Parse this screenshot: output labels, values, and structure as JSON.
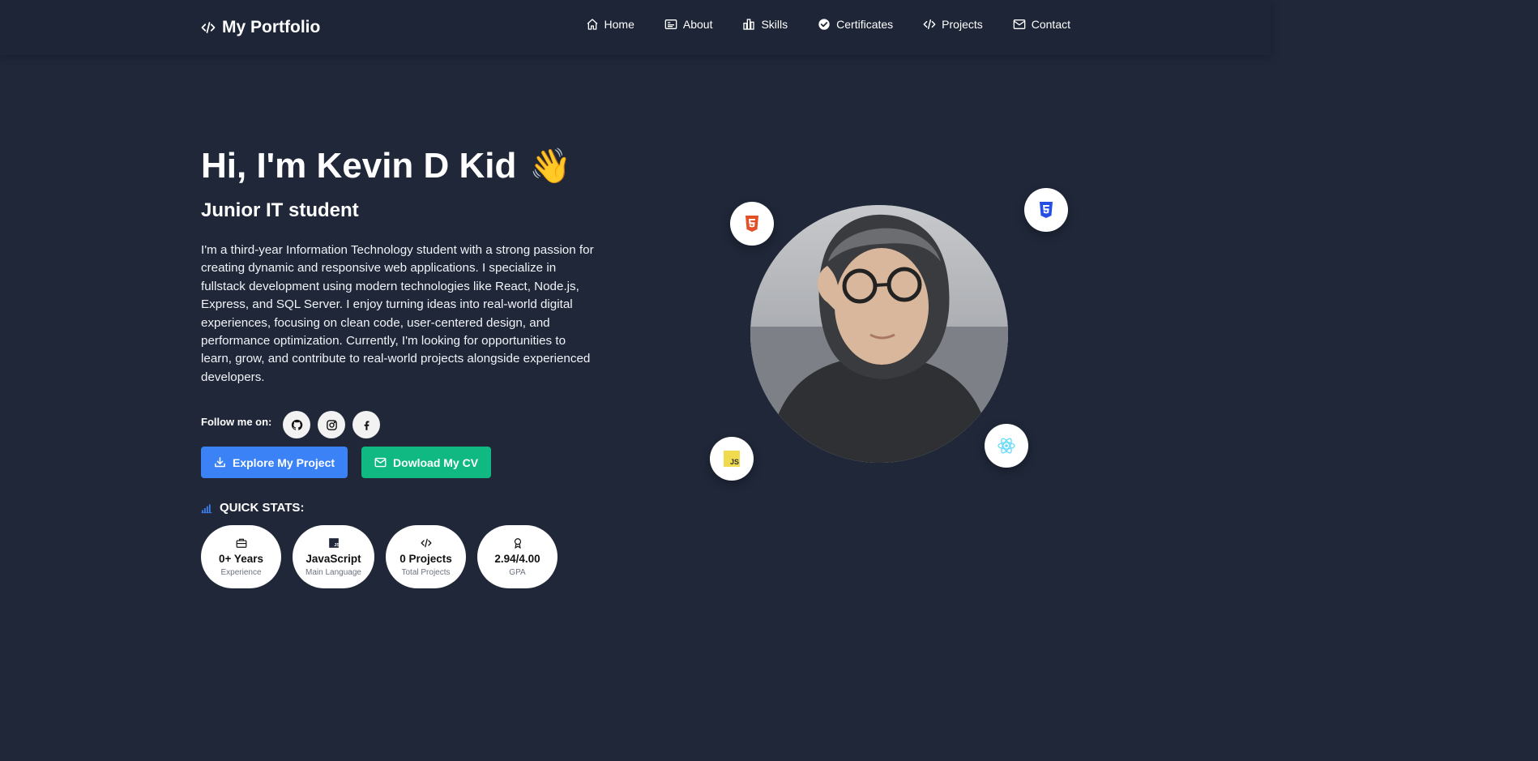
{
  "nav": {
    "brand": "My Portfolio",
    "links": [
      {
        "label": "Home",
        "icon": "home-icon"
      },
      {
        "label": "About",
        "icon": "id-card-icon"
      },
      {
        "label": "Skills",
        "icon": "chart-icon"
      },
      {
        "label": "Certificates",
        "icon": "check-badge-icon"
      },
      {
        "label": "Projects",
        "icon": "code-icon"
      },
      {
        "label": "Contact",
        "icon": "mail-icon"
      }
    ]
  },
  "hero": {
    "greeting": "Hi, I'm Kevin D Kid",
    "wave": "👋",
    "role": "Junior IT student",
    "bio": "I'm a third-year Information Technology student with a strong passion for creating dynamic and responsive web applications. I specialize in fullstack development using modern technologies like React, Node.js, Express, and SQL Server. I enjoy turning ideas into real-world digital experiences, focusing on clean code, user-centered design, and performance optimization. Currently, I'm looking for opportunities to learn, grow, and contribute to real-world projects alongside experienced developers.",
    "follow_label": "Follow me on:",
    "socials": [
      "github-icon",
      "instagram-icon",
      "facebook-icon"
    ],
    "buttons": {
      "explore": "Explore My Project",
      "cv": "Dowload My CV"
    },
    "stats_title": "QUICK STATS:",
    "stats": [
      {
        "value": "0+ Years",
        "label": "Experience",
        "icon": "briefcase-icon"
      },
      {
        "value": "JavaScript",
        "label": "Main Language",
        "icon": "js-icon"
      },
      {
        "value": "0 Projects",
        "label": "Total Projects",
        "icon": "code-icon"
      },
      {
        "value": "2.94/4.00",
        "label": "GPA",
        "icon": "award-icon"
      }
    ]
  },
  "tech_badges": [
    "html5-icon",
    "css3-icon",
    "js-icon",
    "react-icon"
  ],
  "colors": {
    "background": "#1f2739",
    "primary_button": "#3b82f6",
    "secondary_button": "#10b981",
    "html5": "#e34f26",
    "css3": "#1572b6",
    "javascript": "#f7df1e",
    "react": "#61dafb"
  }
}
